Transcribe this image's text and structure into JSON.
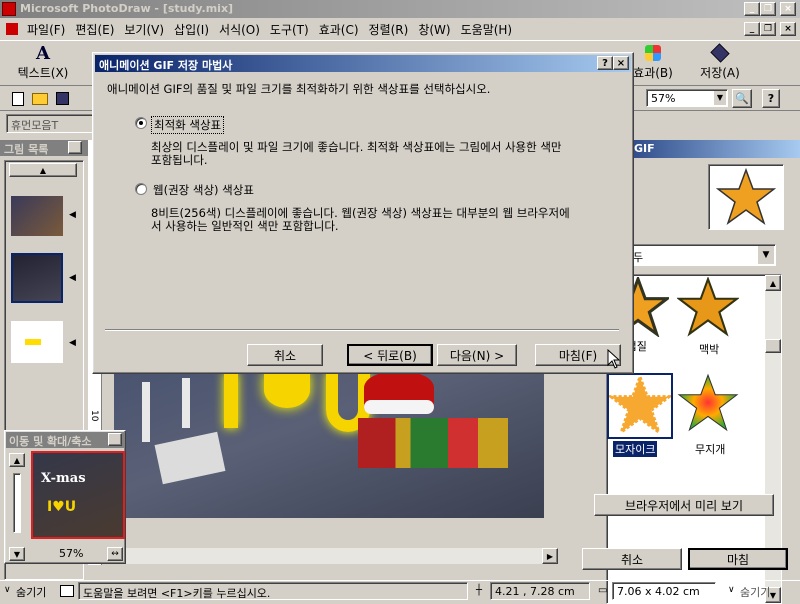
{
  "app": {
    "title": "Microsoft PhotoDraw - [study.mix]"
  },
  "menu": [
    "파일(F)",
    "편집(E)",
    "보기(V)",
    "삽입(I)",
    "서식(O)",
    "도구(T)",
    "효과(C)",
    "정렬(R)",
    "창(W)",
    "도움말(H)"
  ],
  "toolbar": {
    "text_label": "텍스트(X)",
    "effects_label": "효과(B)",
    "save_label": "저장(A)",
    "zoom_value": "57%",
    "font_value": "휴먼모음T"
  },
  "left_panel": {
    "title": "그림 목록"
  },
  "nav_panel": {
    "title": "이동 및 확대/축소",
    "zoom": "57%"
  },
  "right_panel": {
    "title": "GIF",
    "dropdown_value": "두",
    "items": [
      {
        "label": "두 껍질\n마편"
      },
      {
        "label": "맥박"
      },
      {
        "label": "모자이크"
      },
      {
        "label": "무지개"
      }
    ],
    "preview_button": "브라우저에서 미리 보기",
    "cancel_button": "취소",
    "finish_button": "마침"
  },
  "dialog": {
    "title": "애니메이션 GIF 저장 마법사",
    "instruction": "애니메이션 GIF의 품질 및 파일 크기를 최적화하기 위한 색상표를 선택하십시오.",
    "option1_label": "최적화 색상표",
    "option1_desc": "최상의 디스플레이 및 파일 크기에 좋습니다. 최적화 색상표에는 그림에서 사용한 색만 포함됩니다.",
    "option2_label": "웹(권장 색상) 색상표",
    "option2_desc": "8비트(256색) 디스플레이에 좋습니다. 웹(권장 색상) 색상표는 대부분의 웹 브라우저에서 사용하는 일반적인 색만 포함합니다.",
    "cancel": "취소",
    "back": "< 뒤로(B)",
    "next": "다음(N) >",
    "finish": "마침(F)"
  },
  "canvas": {
    "ruler_mark": "10",
    "heart_text": "I♥U",
    "thumb_text": "X-mas"
  },
  "status": {
    "hide_label": "숨기기",
    "help_text": "도움말을 보려면 <F1>키를 누르십시오.",
    "coords": "4.21 , 7.28  cm",
    "size": "7.06 x 4.02  cm",
    "hide_right": "숨기기"
  },
  "colors": {
    "title_start": "#0a246a",
    "title_end": "#a6caf0",
    "face": "#d4d0c8"
  }
}
